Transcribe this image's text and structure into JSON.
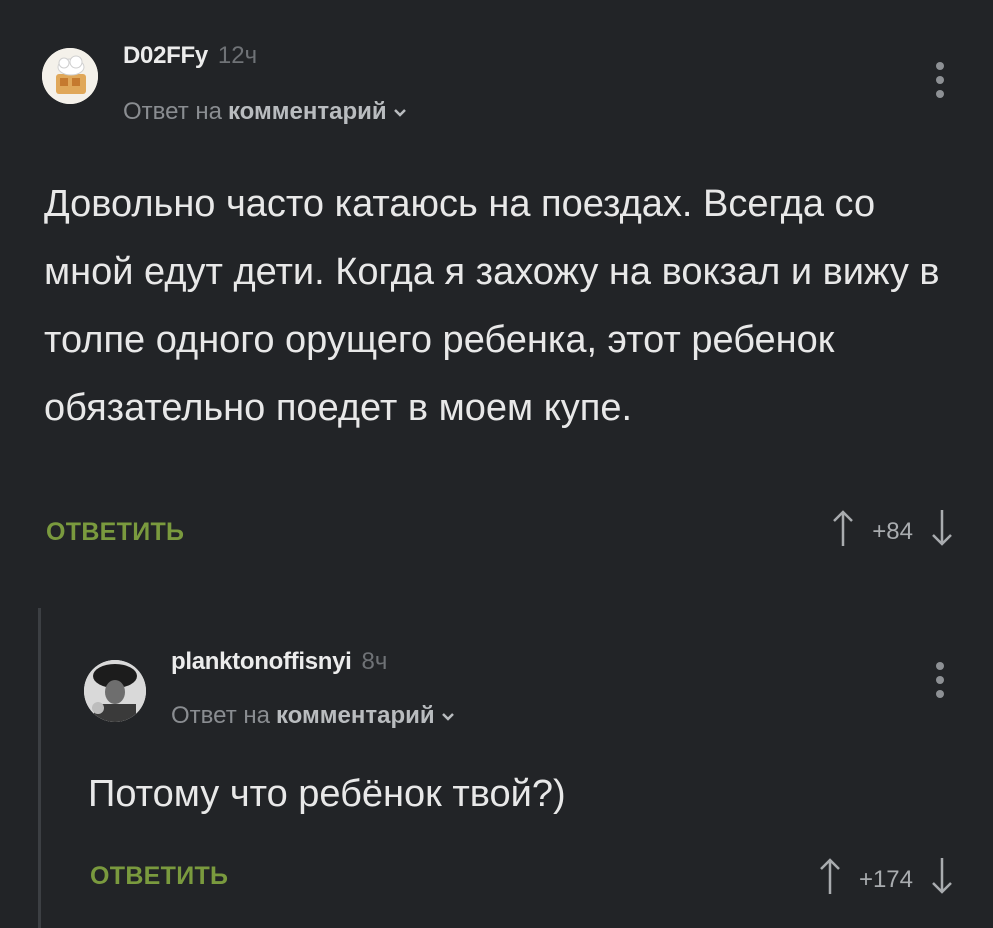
{
  "comments": [
    {
      "username": "D02FFy",
      "time": "12ч",
      "reply_prefix": "Ответ на",
      "reply_link": "комментарий",
      "text": "Довольно часто катаюсь на поездах. Всегда со мной едут дети. Когда я захожу на вокзал и вижу в толпе одного орущего ребенка, этот ребенок обязательно поедет в моем купе.",
      "reply_label": "ОТВЕТИТЬ",
      "score": "+84"
    },
    {
      "username": "planktonoffisnyi",
      "time": "8ч",
      "reply_prefix": "Ответ на",
      "reply_link": "комментарий",
      "text": "Потому что ребёнок твой?)",
      "reply_label": "ОТВЕТИТЬ",
      "score": "+174"
    }
  ],
  "icons": {
    "upvote": "arrow-up-icon",
    "downvote": "arrow-down-icon",
    "menu": "more-vertical-icon",
    "chevron": "chevron-down-icon"
  },
  "colors": {
    "background": "#222427",
    "accent_green": "#7a9a3e",
    "muted": "#8a8d91"
  }
}
